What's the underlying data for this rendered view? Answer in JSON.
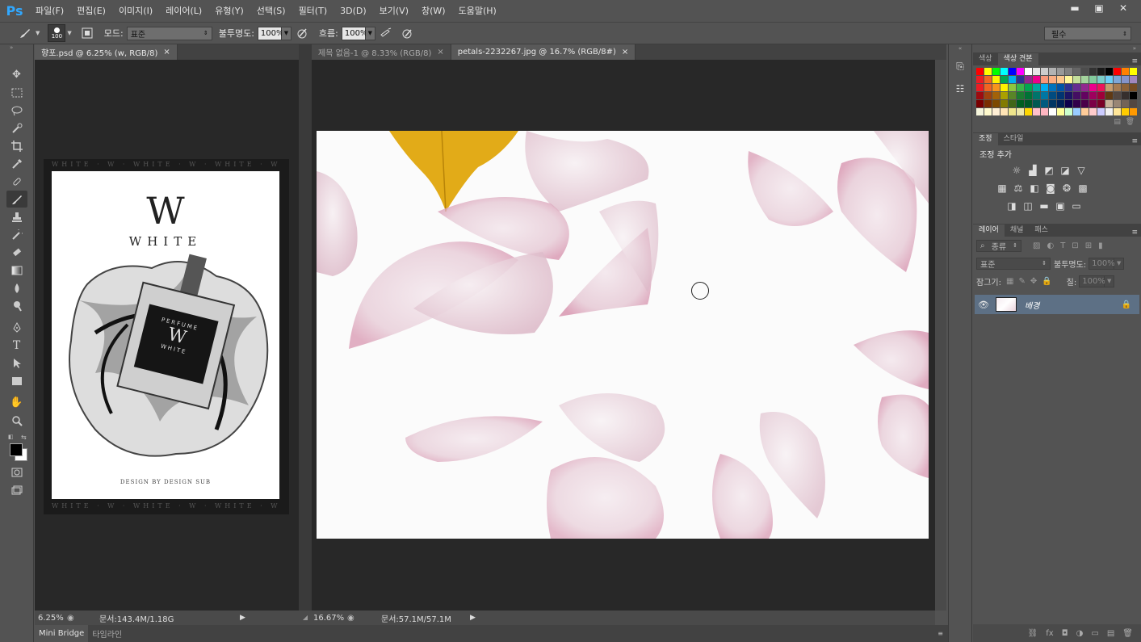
{
  "app": {
    "logo": "Ps"
  },
  "menu": [
    "파일(F)",
    "편집(E)",
    "이미지(I)",
    "레이어(L)",
    "유형(Y)",
    "선택(S)",
    "필터(T)",
    "3D(D)",
    "보기(V)",
    "창(W)",
    "도움말(H)"
  ],
  "window_controls": {
    "minimize": "▬",
    "restore": "▣",
    "close": "✕"
  },
  "options": {
    "brush_size": "100",
    "mode_label": "모드:",
    "mode_value": "표준",
    "opacity_label": "불투명도:",
    "opacity_value": "100%",
    "flow_label": "흐름:",
    "flow_value": "100%",
    "workspace": "필수"
  },
  "tabs_left": [
    {
      "label": "향포.psd @ 6.25% (w, RGB/8)",
      "close": "×"
    }
  ],
  "tabs_right": [
    {
      "label": "제목 없음-1 @ 8.33% (RGB/8)",
      "close": "×"
    },
    {
      "label": "petals-2232267.jpg @ 16.7% (RGB/8#)",
      "close": "×"
    }
  ],
  "status_left": {
    "zoom": "6.25%",
    "doc": "문서:143.4M/1.18G"
  },
  "status_right": {
    "zoom": "16.67%",
    "doc": "문서:57.1M/57.1M"
  },
  "bottom_tabs": [
    "Mini Bridge",
    "타임라인"
  ],
  "poster": {
    "monogram": "W",
    "title": "WHITE",
    "label_top": "PERFUME",
    "label_letter": "W",
    "label_bottom": "WHITE",
    "credit": "DESIGN BY DESIGN SUB",
    "border_text": "WHITE · W · WHITE · W · WHITE · W"
  },
  "panels": {
    "color_tabs": [
      "색상",
      "색상 견본"
    ],
    "adjust_tabs": [
      "조정",
      "스타일"
    ],
    "adjust_title": "조정 추가",
    "layer_tabs": [
      "레이어",
      "채널",
      "패스"
    ],
    "filter_kind": "종류",
    "blend_mode": "표준",
    "opacity_label": "불투명도:",
    "opacity_value": "100%",
    "lock_label": "잠그기:",
    "fill_label": "칠:",
    "fill_value": "100%",
    "layer_name": "배경"
  },
  "swatch_colors": [
    "#ff0000",
    "#ffff00",
    "#00ff00",
    "#00ffff",
    "#0000ff",
    "#ff00ff",
    "#ffffff",
    "#e6e6e6",
    "#cccccc",
    "#b3b3b3",
    "#999999",
    "#808080",
    "#666666",
    "#4d4d4d",
    "#333333",
    "#1a1a1a",
    "#000000",
    "#ff0000",
    "#ff8000",
    "#ffff00",
    "#ed1c24",
    "#f26522",
    "#fff200",
    "#00a651",
    "#00aeef",
    "#2e3192",
    "#92278f",
    "#ec008c",
    "#f7977a",
    "#fbad82",
    "#fdc68c",
    "#fff799",
    "#c4df9b",
    "#a3d39c",
    "#82ca9c",
    "#7bcdc8",
    "#6ecff6",
    "#7ea7d8",
    "#8493ca",
    "#a187be",
    "#ed1c24",
    "#f26522",
    "#f7941d",
    "#fff200",
    "#8dc63f",
    "#39b54a",
    "#00a651",
    "#00a99d",
    "#00aeef",
    "#0072bc",
    "#0054a6",
    "#2e3192",
    "#662d91",
    "#92278f",
    "#ec008c",
    "#ed145b",
    "#c69c6d",
    "#a67c52",
    "#8c6239",
    "#754c24",
    "#9e0b0f",
    "#a0410d",
    "#a36209",
    "#aba000",
    "#598527",
    "#1a7b30",
    "#007236",
    "#00746b",
    "#0076a3",
    "#004b80",
    "#003471",
    "#1b1464",
    "#440e62",
    "#630460",
    "#9e005d",
    "#9e0039",
    "#603913",
    "#534741",
    "#362f2d",
    "#000000",
    "#790000",
    "#7b2e00",
    "#7d4900",
    "#827b00",
    "#406618",
    "#005e20",
    "#005826",
    "#005952",
    "#005b7f",
    "#003663",
    "#002157",
    "#0d004c",
    "#32004b",
    "#4b0049",
    "#7b0046",
    "#7a0026",
    "#c7b299",
    "#998675",
    "#736357",
    "#534741",
    "#f5f5dc",
    "#fffacd",
    "#ffefd5",
    "#ffe4b5",
    "#f0e68c",
    "#eee8aa",
    "#ffd700",
    "#ffc0cb",
    "#ffb6c1",
    "#ffffff",
    "#ffff99",
    "#ccffcc",
    "#99ccff",
    "#ffcc99",
    "#ffcccc",
    "#ccccff",
    "#f2f2f2",
    "#ffe699",
    "#ffcc00",
    "#ff9900"
  ]
}
